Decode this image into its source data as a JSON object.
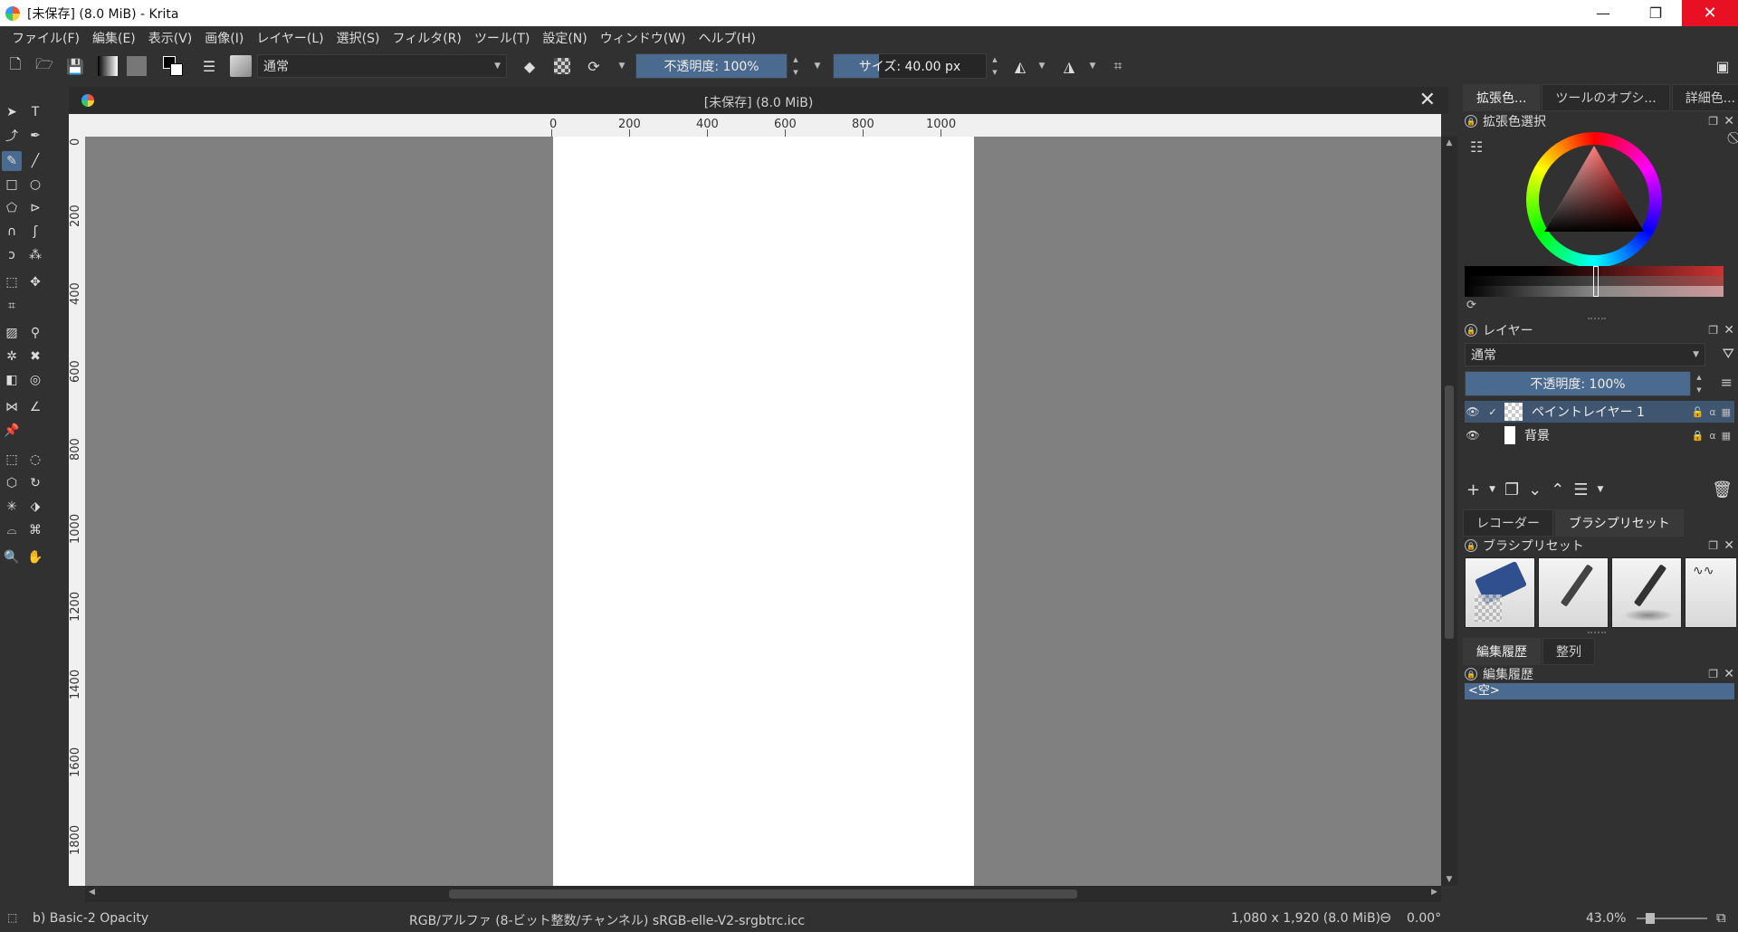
{
  "window": {
    "title": "[未保存]  (8.0 MiB)  - Krita",
    "controls": {
      "minimize": "—",
      "maximize": "❐",
      "close": "✕"
    }
  },
  "menu": [
    "ファイル(F)",
    "編集(E)",
    "表示(V)",
    "画像(I)",
    "レイヤー(L)",
    "選択(S)",
    "フィルタ(R)",
    "ツール(T)",
    "設定(N)",
    "ウィンドウ(W)",
    "ヘルプ(H)"
  ],
  "toolbar": {
    "blend_mode": "通常",
    "opacity_label": "不透明度: 100%",
    "opacity_value": 100,
    "size_label": "サイズ: 40.00 px",
    "size_fill_fraction": 0.3
  },
  "document": {
    "tab_title": "[未保存]  (8.0 MiB)",
    "close_glyph": "✕",
    "ruler_h_labels": [
      "0",
      "200",
      "400",
      "600",
      "800",
      "1000"
    ],
    "ruler_v_labels": [
      "0",
      "200",
      "400",
      "600",
      "800",
      "1000",
      "1200",
      "1400",
      "1600",
      "1800"
    ]
  },
  "dockers": {
    "top_tabs": [
      "拡張色...",
      "ツールのオプシ...",
      "詳細色..."
    ],
    "color_selector_title": "拡張色選択",
    "layers": {
      "title": "レイヤー",
      "blend_mode": "通常",
      "opacity_label": "不透明度:  100%",
      "items": [
        {
          "name": "ペイントレイヤー 1",
          "selected": true
        },
        {
          "name": "背景",
          "selected": false
        }
      ]
    },
    "mid_tabs": [
      "レコーダー",
      "ブラシプリセット"
    ],
    "brush_presets_title": "ブラシプリセット",
    "bottom_tabs": [
      "編集履歴",
      "整列"
    ],
    "history_title": "編集履歴",
    "history_items": [
      "<空>"
    ]
  },
  "status": {
    "brush": "b) Basic-2 Opacity",
    "color_profile": "RGB/アルファ (8-ビット整数/チャンネル)  sRGB-elle-V2-srgbtrc.icc",
    "dimensions": "1,080 x 1,920 (8.0 MiB)",
    "rotation": "0.00°",
    "zoom": "43.0%"
  },
  "colors": {
    "accent": "#4b6a8f",
    "canvas_bg": "#808080",
    "ui_bg": "#313131",
    "close_red": "#e81123"
  }
}
